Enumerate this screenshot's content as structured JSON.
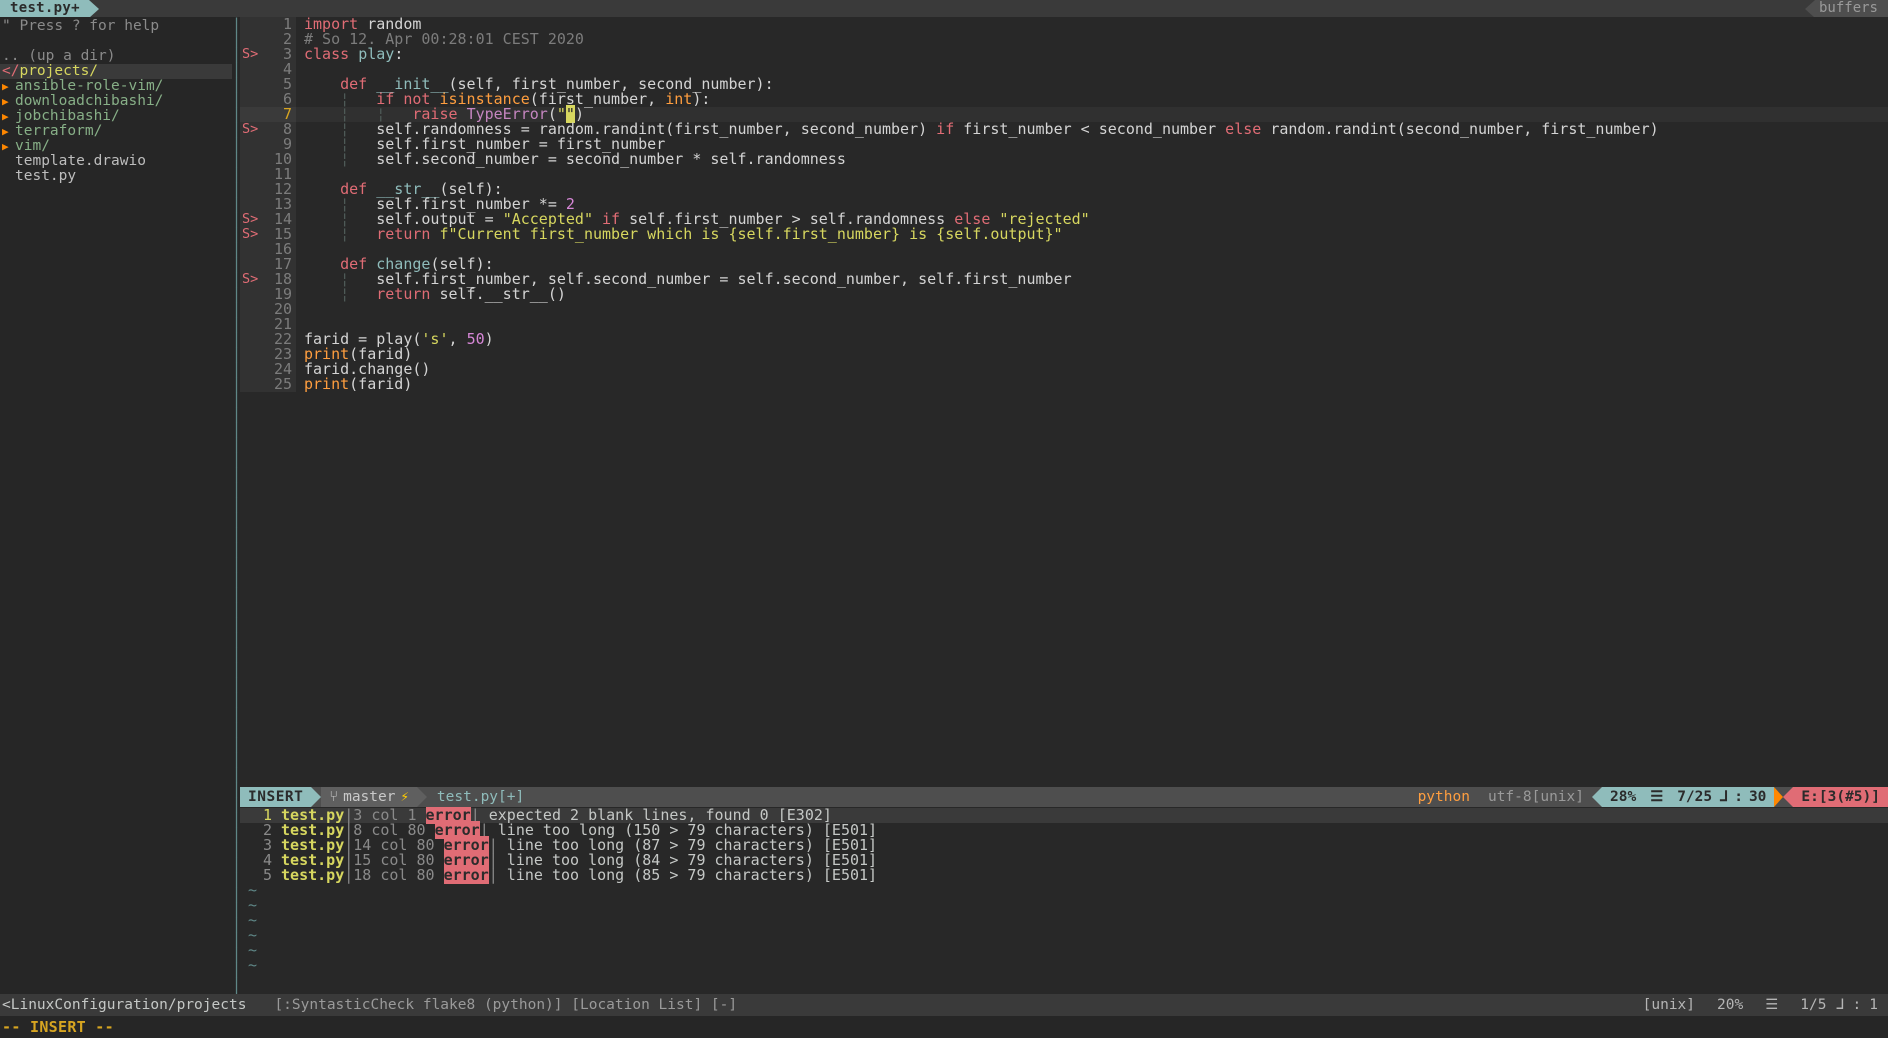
{
  "tabline": {
    "active_tab": "test.py+",
    "right_tab": "buffers"
  },
  "sidebar": {
    "help_hint": "\" Press ? for help",
    "up_dir": ".. (up a dir)",
    "cwd_prefix": "</",
    "cwd": "projects/",
    "items": [
      {
        "label": "ansible-role-vim/",
        "type": "dir"
      },
      {
        "label": "downloadchibashi/",
        "type": "dir"
      },
      {
        "label": "jobchibashi/",
        "type": "dir"
      },
      {
        "label": "terraform/",
        "type": "dir"
      },
      {
        "label": "vim/",
        "type": "dir"
      },
      {
        "label": "template.drawio",
        "type": "file"
      },
      {
        "label": "test.py",
        "type": "file"
      }
    ]
  },
  "editor": {
    "filename": "test.py",
    "lines": [
      {
        "n": 1,
        "sign": "",
        "cursor": false,
        "tokens": [
          {
            "t": "import ",
            "c": "kw"
          },
          {
            "t": "random",
            "c": "plain"
          }
        ]
      },
      {
        "n": 2,
        "sign": "",
        "cursor": false,
        "tokens": [
          {
            "t": "# So 12. Apr 00:28:01 CEST 2020",
            "c": "cmt"
          }
        ]
      },
      {
        "n": 3,
        "sign": "S>",
        "cursor": false,
        "tokens": [
          {
            "t": "class ",
            "c": "kw"
          },
          {
            "t": "play",
            "c": "fn"
          },
          {
            "t": ":",
            "c": "plain"
          }
        ]
      },
      {
        "n": 4,
        "sign": "",
        "cursor": false,
        "tokens": []
      },
      {
        "n": 5,
        "sign": "",
        "cursor": false,
        "tokens": [
          {
            "t": "    ",
            "c": "plain"
          },
          {
            "t": "def ",
            "c": "kw"
          },
          {
            "t": "__init__",
            "c": "fn"
          },
          {
            "t": "(self, first_number, second_number):",
            "c": "plain"
          }
        ]
      },
      {
        "n": 6,
        "sign": "",
        "cursor": false,
        "tokens": [
          {
            "t": "    ",
            "c": "plain"
          },
          {
            "t": "¦",
            "c": "ind"
          },
          {
            "t": "   ",
            "c": "plain"
          },
          {
            "t": "if not ",
            "c": "kw"
          },
          {
            "t": "isinstance",
            "c": "bi"
          },
          {
            "t": "(first_number, ",
            "c": "plain"
          },
          {
            "t": "int",
            "c": "bi"
          },
          {
            "t": "):",
            "c": "plain"
          }
        ]
      },
      {
        "n": 7,
        "sign": "",
        "cursor": true,
        "tokens": [
          {
            "t": "    ",
            "c": "plain"
          },
          {
            "t": "¦",
            "c": "ind"
          },
          {
            "t": "   ",
            "c": "plain"
          },
          {
            "t": "¦",
            "c": "ind"
          },
          {
            "t": "   ",
            "c": "plain"
          },
          {
            "t": "raise ",
            "c": "kw"
          },
          {
            "t": "TypeError",
            "c": "ex"
          },
          {
            "t": "(",
            "c": "plain"
          },
          {
            "t": "\"",
            "c": "str"
          },
          {
            "t": "\"",
            "c": "curs"
          },
          {
            "t": ")",
            "c": "plain"
          }
        ]
      },
      {
        "n": 8,
        "sign": "S>",
        "cursor": false,
        "tokens": [
          {
            "t": "    ",
            "c": "plain"
          },
          {
            "t": "¦",
            "c": "ind"
          },
          {
            "t": "   ",
            "c": "plain"
          },
          {
            "t": "self.randomness = random.randint(first_number, second_number) ",
            "c": "plain"
          },
          {
            "t": "if",
            "c": "kw"
          },
          {
            "t": " first_number < second_number ",
            "c": "plain"
          },
          {
            "t": "else",
            "c": "kw"
          },
          {
            "t": " random.randint(second_number, first_number)",
            "c": "plain"
          }
        ]
      },
      {
        "n": 9,
        "sign": "",
        "cursor": false,
        "tokens": [
          {
            "t": "    ",
            "c": "plain"
          },
          {
            "t": "¦",
            "c": "ind"
          },
          {
            "t": "   ",
            "c": "plain"
          },
          {
            "t": "self.first_number = first_number",
            "c": "plain"
          }
        ]
      },
      {
        "n": 10,
        "sign": "",
        "cursor": false,
        "tokens": [
          {
            "t": "    ",
            "c": "plain"
          },
          {
            "t": "¦",
            "c": "ind"
          },
          {
            "t": "   ",
            "c": "plain"
          },
          {
            "t": "self.second_number = second_number * self.randomness",
            "c": "plain"
          }
        ]
      },
      {
        "n": 11,
        "sign": "",
        "cursor": false,
        "tokens": []
      },
      {
        "n": 12,
        "sign": "",
        "cursor": false,
        "tokens": [
          {
            "t": "    ",
            "c": "plain"
          },
          {
            "t": "def ",
            "c": "kw"
          },
          {
            "t": "__str__",
            "c": "fn"
          },
          {
            "t": "(self):",
            "c": "plain"
          }
        ]
      },
      {
        "n": 13,
        "sign": "",
        "cursor": false,
        "tokens": [
          {
            "t": "    ",
            "c": "plain"
          },
          {
            "t": "¦",
            "c": "ind"
          },
          {
            "t": "   ",
            "c": "plain"
          },
          {
            "t": "self.first_number *= ",
            "c": "plain"
          },
          {
            "t": "2",
            "c": "num"
          }
        ]
      },
      {
        "n": 14,
        "sign": "S>",
        "cursor": false,
        "tokens": [
          {
            "t": "    ",
            "c": "plain"
          },
          {
            "t": "¦",
            "c": "ind"
          },
          {
            "t": "   ",
            "c": "plain"
          },
          {
            "t": "self.output = ",
            "c": "plain"
          },
          {
            "t": "\"Accepted\"",
            "c": "str"
          },
          {
            "t": " ",
            "c": "plain"
          },
          {
            "t": "if",
            "c": "kw"
          },
          {
            "t": " self.first_number > self.randomness ",
            "c": "plain"
          },
          {
            "t": "else",
            "c": "kw"
          },
          {
            "t": " ",
            "c": "plain"
          },
          {
            "t": "\"rejected\"",
            "c": "str"
          }
        ]
      },
      {
        "n": 15,
        "sign": "S>",
        "cursor": false,
        "tokens": [
          {
            "t": "    ",
            "c": "plain"
          },
          {
            "t": "¦",
            "c": "ind"
          },
          {
            "t": "   ",
            "c": "plain"
          },
          {
            "t": "return ",
            "c": "kw"
          },
          {
            "t": "f\"Current first_number which is {self.first_number} is {self.output}\"",
            "c": "str"
          }
        ]
      },
      {
        "n": 16,
        "sign": "",
        "cursor": false,
        "tokens": []
      },
      {
        "n": 17,
        "sign": "",
        "cursor": false,
        "tokens": [
          {
            "t": "    ",
            "c": "plain"
          },
          {
            "t": "def ",
            "c": "kw"
          },
          {
            "t": "change",
            "c": "fn"
          },
          {
            "t": "(self):",
            "c": "plain"
          }
        ]
      },
      {
        "n": 18,
        "sign": "S>",
        "cursor": false,
        "tokens": [
          {
            "t": "    ",
            "c": "plain"
          },
          {
            "t": "¦",
            "c": "ind"
          },
          {
            "t": "   ",
            "c": "plain"
          },
          {
            "t": "self.first_number, self.second_number = self.second_number, self.first_number",
            "c": "plain"
          }
        ]
      },
      {
        "n": 19,
        "sign": "",
        "cursor": false,
        "tokens": [
          {
            "t": "    ",
            "c": "plain"
          },
          {
            "t": "¦",
            "c": "ind"
          },
          {
            "t": "   ",
            "c": "plain"
          },
          {
            "t": "return ",
            "c": "kw"
          },
          {
            "t": "self.__str__()",
            "c": "plain"
          }
        ]
      },
      {
        "n": 20,
        "sign": "",
        "cursor": false,
        "tokens": []
      },
      {
        "n": 21,
        "sign": "",
        "cursor": false,
        "tokens": []
      },
      {
        "n": 22,
        "sign": "",
        "cursor": false,
        "tokens": [
          {
            "t": "farid = play(",
            "c": "plain"
          },
          {
            "t": "'s'",
            "c": "str"
          },
          {
            "t": ", ",
            "c": "plain"
          },
          {
            "t": "50",
            "c": "num"
          },
          {
            "t": ")",
            "c": "plain"
          }
        ]
      },
      {
        "n": 23,
        "sign": "",
        "cursor": false,
        "tokens": [
          {
            "t": "print",
            "c": "bi"
          },
          {
            "t": "(farid)",
            "c": "plain"
          }
        ]
      },
      {
        "n": 24,
        "sign": "",
        "cursor": false,
        "tokens": [
          {
            "t": "farid.change()",
            "c": "plain"
          }
        ]
      },
      {
        "n": 25,
        "sign": "",
        "cursor": false,
        "tokens": [
          {
            "t": "print",
            "c": "bi"
          },
          {
            "t": "(farid)",
            "c": "plain"
          }
        ]
      }
    ]
  },
  "statusline": {
    "mode": "INSERT",
    "branch": "master",
    "branch_icon": "⚡",
    "file": "test.py[+]",
    "filetype": "python",
    "encoding": "utf-8[unix]",
    "percent": "28%",
    "line_icon": "☰",
    "position": "7/25",
    "col_icon": "⅃",
    "col_sep": ":",
    "column": "30",
    "errors": "E:[3(#5)]"
  },
  "loclist": {
    "rows": [
      {
        "idx": "1",
        "file": "test.py",
        "pos": "3 col 1",
        "type": "error",
        "msg": "expected 2 blank lines, found 0 [E302]",
        "selected": true
      },
      {
        "idx": "2",
        "file": "test.py",
        "pos": "8 col 80",
        "type": "error",
        "msg": "line too long (150 > 79 characters) [E501]",
        "selected": false
      },
      {
        "idx": "3",
        "file": "test.py",
        "pos": "14 col 80",
        "type": "error",
        "msg": "line too long (87 > 79 characters) [E501]",
        "selected": false
      },
      {
        "idx": "4",
        "file": "test.py",
        "pos": "15 col 80",
        "type": "error",
        "msg": "line too long (84 > 79 characters) [E501]",
        "selected": false
      },
      {
        "idx": "5",
        "file": "test.py",
        "pos": "18 col 80",
        "type": "error",
        "msg": "line too long (85 > 79 characters) [E501]",
        "selected": false
      }
    ]
  },
  "bottomline": {
    "left": "<LinuxConfiguration/projects",
    "middle": "[:SyntasticCheck flake8 (python)] [Location List] [-]",
    "format": "[unix]",
    "percent": "20%",
    "line_icon": "☰",
    "position": "1/5",
    "col_icon": "⅃",
    "col_sep": ":",
    "column": "1"
  },
  "cmdline": {
    "text": "-- INSERT --"
  }
}
